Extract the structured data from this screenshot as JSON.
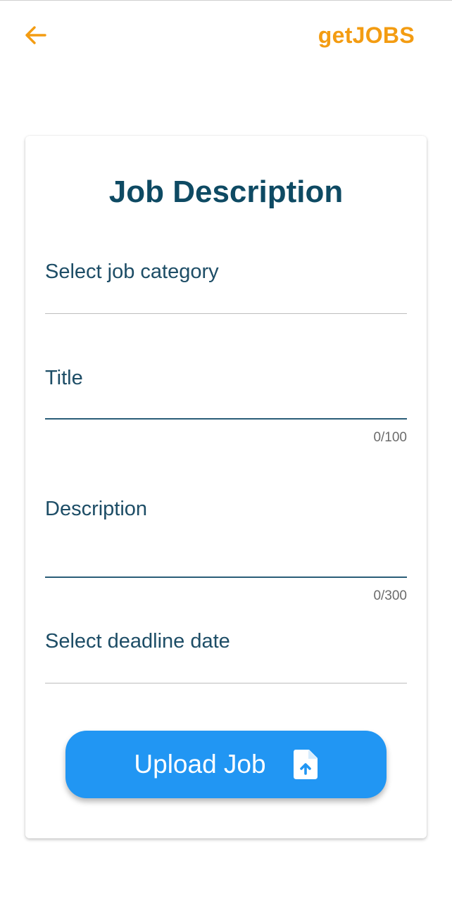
{
  "app": {
    "brand": "getJOBS",
    "accent_color": "#f39c12",
    "back_icon": "arrow-left-icon"
  },
  "form": {
    "title": "Job Description",
    "category": {
      "label": "Select job category",
      "value": ""
    },
    "job_title": {
      "label": "Title",
      "value": "",
      "counter": "0/100"
    },
    "description": {
      "label": "Description",
      "value": "",
      "counter": "0/300"
    },
    "deadline": {
      "label": "Select deadline date",
      "value": ""
    },
    "submit": {
      "label": "Upload Job",
      "icon": "file-upload-icon",
      "color": "#2196f3"
    }
  }
}
